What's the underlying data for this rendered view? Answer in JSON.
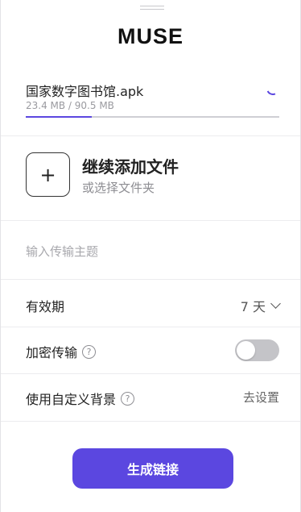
{
  "app": {
    "title": "MUSE"
  },
  "file": {
    "name": "国家数字图书馆.apk",
    "size_text": "23.4 MB / 90.5 MB",
    "progress_fraction": 0.259
  },
  "add_files": {
    "icon": "plus-icon",
    "title": "继续添加文件",
    "subtitle": "或选择文件夹"
  },
  "subject": {
    "placeholder": "输入传输主题",
    "value": ""
  },
  "expiry": {
    "label": "有效期",
    "value": "7 天"
  },
  "encryption": {
    "label": "加密传输",
    "enabled": false
  },
  "custom_background": {
    "label": "使用自定义背景",
    "action": "去设置"
  },
  "generate_button": {
    "label": "生成链接"
  },
  "colors": {
    "accent": "#5b47e0",
    "toggle_off": "#c4c4c8"
  }
}
